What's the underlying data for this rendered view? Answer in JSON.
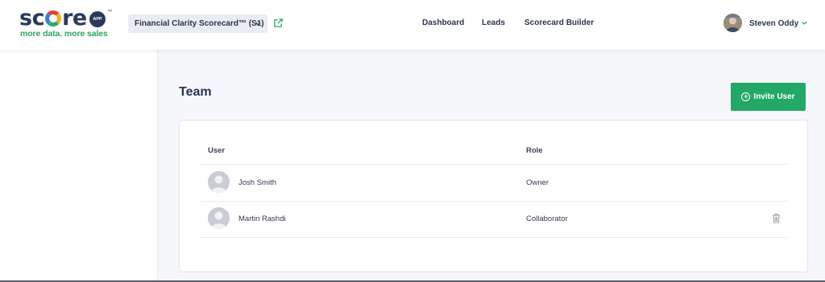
{
  "header": {
    "logo_word": [
      "sc",
      "re"
    ],
    "logo_badge": "APP",
    "logo_tm": "™",
    "tagline": "more data. more sales",
    "scorecard_selected": "Financial Clarity Scorecard™ (S1)",
    "nav": [
      "Dashboard",
      "Leads",
      "Scorecard Builder"
    ],
    "user_name": "Steven Oddy"
  },
  "icons": {
    "dropdown": "chevron-down-icon",
    "external": "external-link-icon",
    "invite": "plus-circle-icon",
    "delete": "trash-icon"
  },
  "colors": {
    "brand_navy": "#2a3a5c",
    "brand_green": "#23a867",
    "background": "#f6f7fa"
  },
  "page": {
    "title": "Team",
    "invite_label": "Invite User"
  },
  "table": {
    "columns": [
      "User",
      "Role"
    ],
    "rows": [
      {
        "name": "Josh Smith",
        "role": "Owner"
      },
      {
        "name": "Martin Rashdi",
        "role": "Collaborator"
      }
    ]
  }
}
